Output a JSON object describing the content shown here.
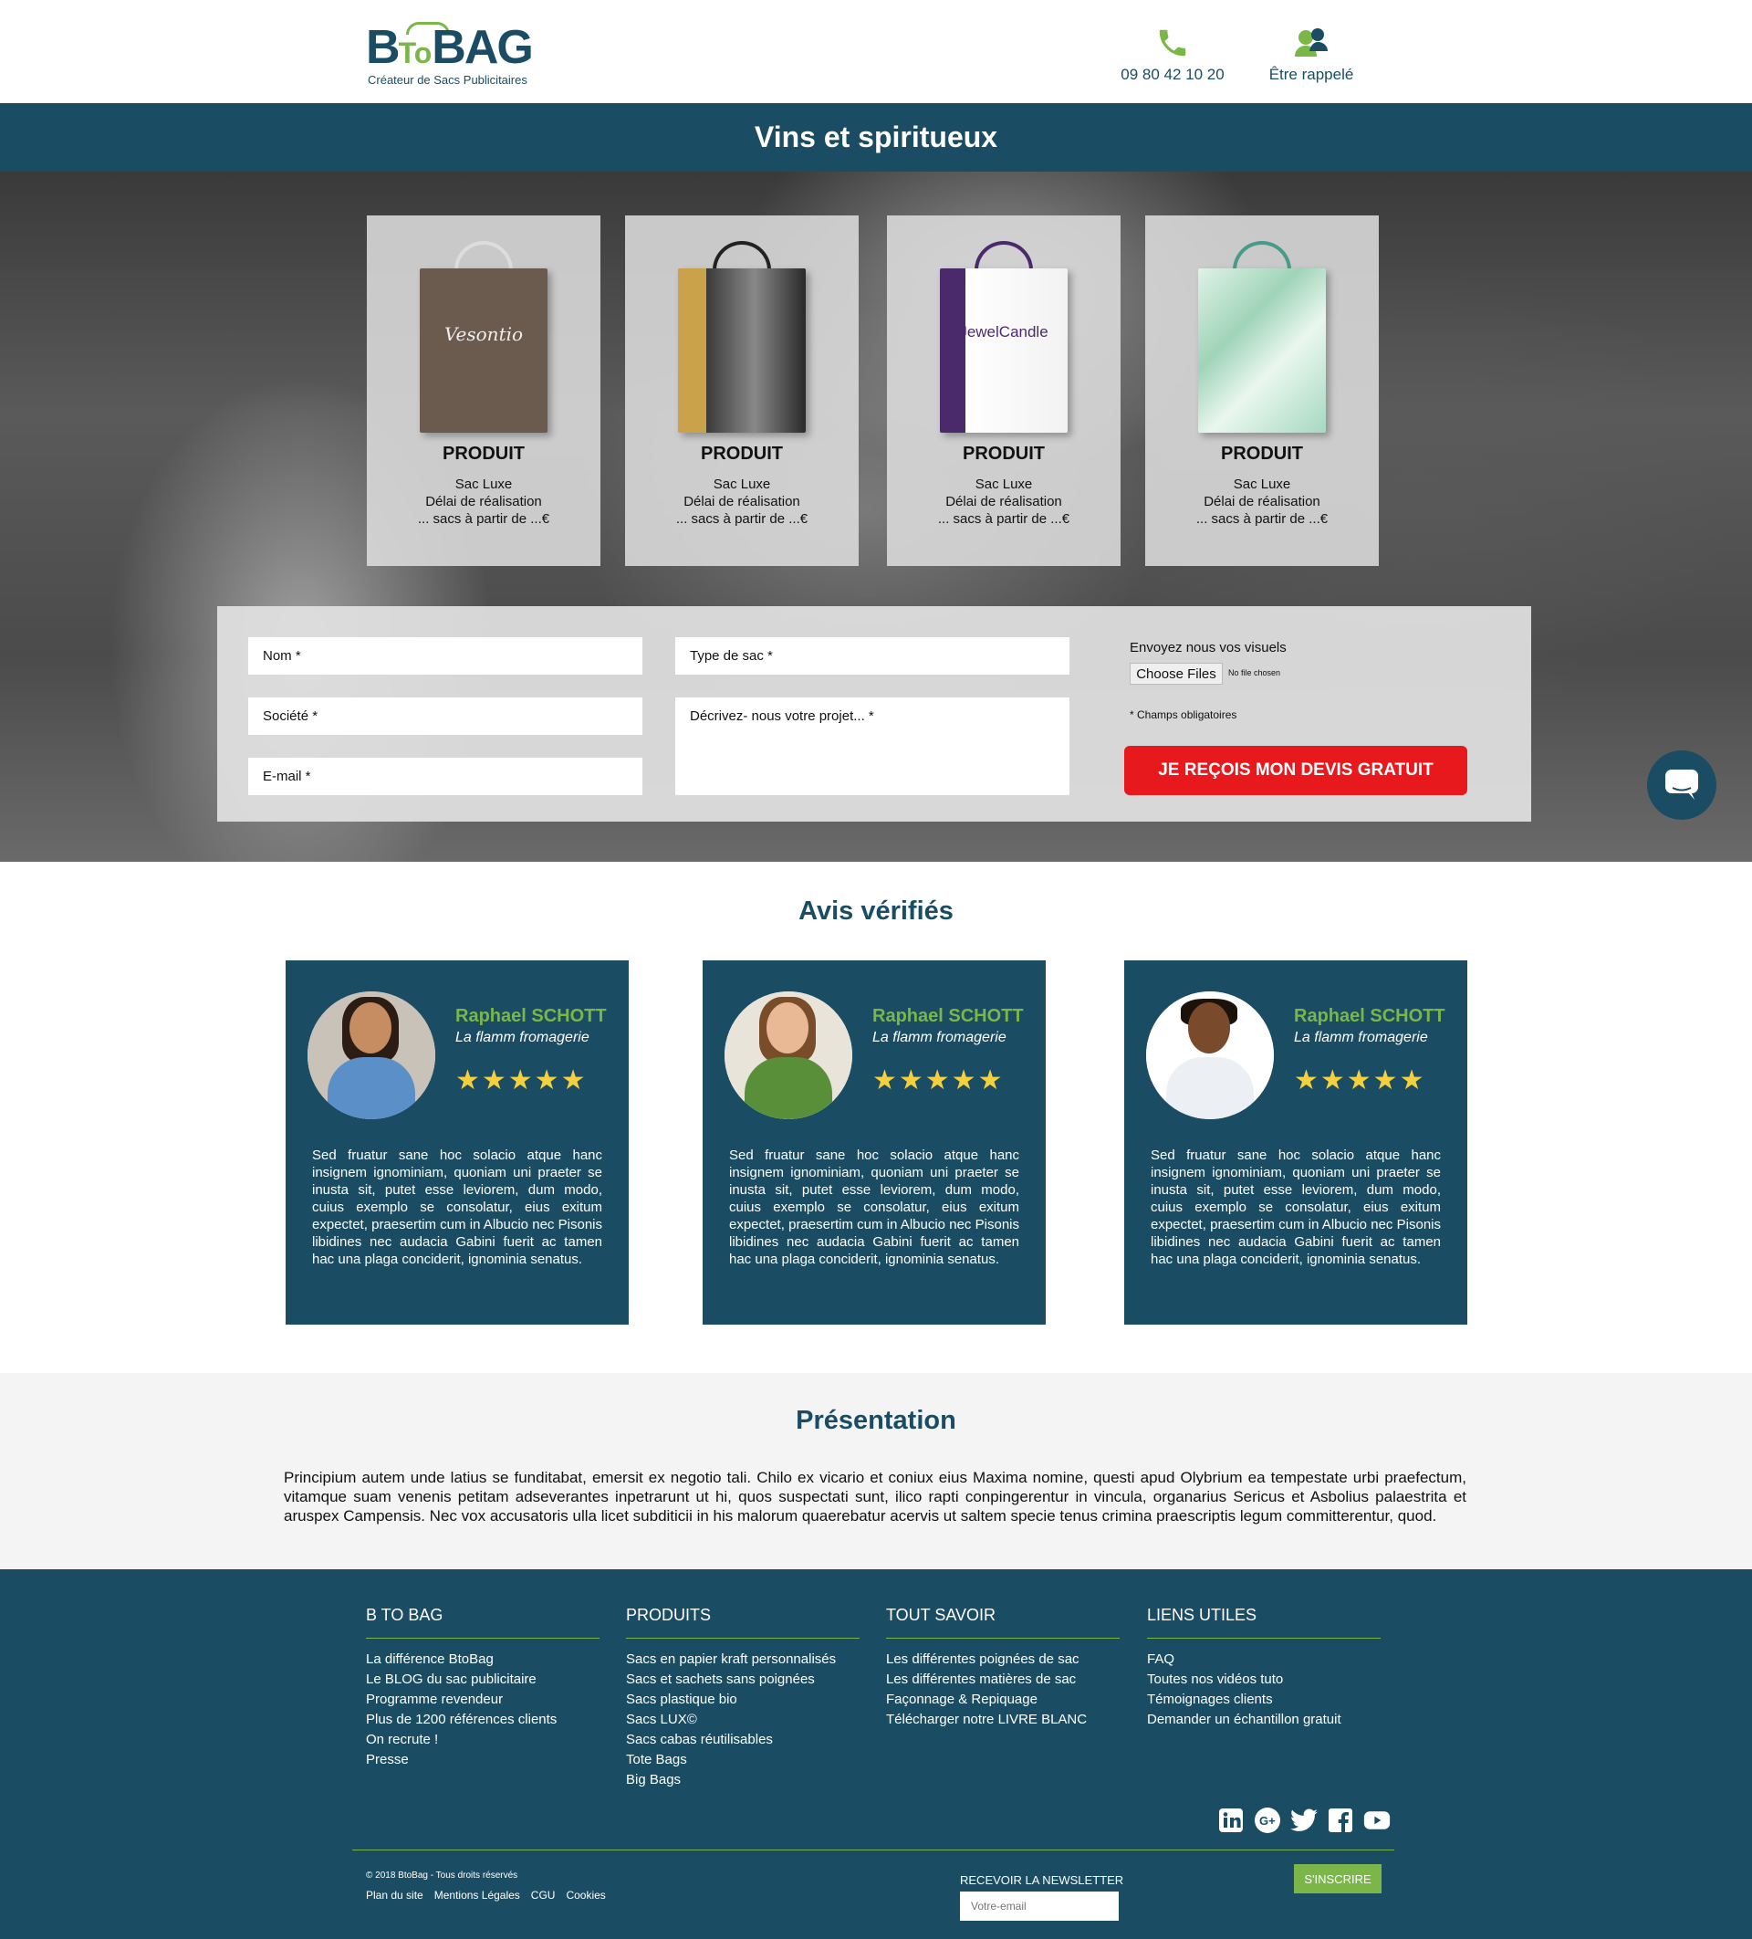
{
  "header": {
    "logo_main": "BtoBAG",
    "logo_tagline": "Créateur de Sacs Publicitaires",
    "phone": "09 80 42 10 20",
    "callback": "Être rappelé"
  },
  "page_title": "Vins et spiritueux",
  "products": [
    {
      "title": "PRODUIT",
      "line1": "Sac Luxe",
      "line2": "Délai de réalisation",
      "line3": "... sacs à partir de ...€",
      "bag_brand": "Vesontio",
      "bag_color": "#6b5a4e"
    },
    {
      "title": "PRODUIT",
      "line1": "Sac Luxe",
      "line2": "Délai de réalisation",
      "line3": "... sacs à partir de ...€",
      "bag_brand": "",
      "bag_color": "#c9a24a"
    },
    {
      "title": "PRODUIT",
      "line1": "Sac Luxe",
      "line2": "Délai de réalisation",
      "line3": "... sacs à partir de ...€",
      "bag_brand": "JewelCandle",
      "bag_color": "#4b2a6b"
    },
    {
      "title": "PRODUIT",
      "line1": "Sac Luxe",
      "line2": "Délai de réalisation",
      "line3": "... sacs à partir de ...€",
      "bag_brand": "",
      "bag_color": "#bfe3cf"
    }
  ],
  "form": {
    "nom": "Nom *",
    "societe": "Société *",
    "email": "E-mail *",
    "type_sac": "Type de sac *",
    "projet": "Décrivez- nous votre projet... *",
    "upload_label": "Envoyez nous vos visuels",
    "choose_files": "Choose Files",
    "no_file": "No file chosen",
    "required_note": "* Champs obligatoires",
    "submit": "JE REÇOIS MON DEVIS GRATUIT"
  },
  "reviews": {
    "title": "Avis vérifiés",
    "items": [
      {
        "name": "Raphael SCHOTT",
        "company": "La flamm fromagerie",
        "stars": "★★★★★",
        "text": "Sed fruatur sane hoc solacio atque hanc insignem ignominiam, quoniam uni praeter se inusta sit, putet esse leviorem, dum modo, cuius exemplo se consolatur, eius exitum expectet, praesertim cum in Albucio nec Pisonis libidines nec audacia Gabini fuerit ac tamen hac una plaga conciderit, ignominia senatus."
      },
      {
        "name": "Raphael SCHOTT",
        "company": "La flamm fromagerie",
        "stars": "★★★★★",
        "text": "Sed fruatur sane hoc solacio atque hanc insignem ignominiam, quoniam uni praeter se inusta sit, putet esse leviorem, dum modo, cuius exemplo se consolatur, eius exitum expectet, praesertim cum in Albucio nec Pisonis libidines nec audacia Gabini fuerit ac tamen hac una plaga conciderit, ignominia senatus."
      },
      {
        "name": "Raphael SCHOTT",
        "company": "La flamm fromagerie",
        "stars": "★★★★★",
        "text": "Sed fruatur sane hoc solacio atque hanc insignem ignominiam, quoniam uni praeter se inusta sit, putet esse leviorem, dum modo, cuius exemplo se consolatur, eius exitum expectet, praesertim cum in Albucio nec Pisonis libidines nec audacia Gabini fuerit ac tamen hac una plaga conciderit, ignominia senatus."
      }
    ]
  },
  "presentation": {
    "title": "Présentation",
    "text": "Principium autem unde latius se funditabat, emersit ex negotio tali. Chilo ex vicario et coniux eius Maxima nomine, questi apud Olybrium ea tempestate urbi praefectum, vitamque suam venenis petitam adseverantes inpetrarunt ut hi, quos suspectati sunt, ilico rapti conpingerentur in vincula, organarius Sericus et Asbolius palaestrita et aruspex Campensis. Nec vox accusatoris ulla licet subditicii in his malorum quaerebatur acervis ut saltem specie tenus crimina praescriptis legum committerentur, quod."
  },
  "footer": {
    "columns": [
      {
        "title": "B TO BAG",
        "items": [
          "La différence BtoBag",
          "Le BLOG du sac publicitaire",
          "Programme revendeur",
          "Plus de 1200 références clients",
          "On recrute !",
          "Presse"
        ]
      },
      {
        "title": "PRODUITS",
        "items": [
          "Sacs en papier kraft personnalisés",
          "Sacs et sachets sans poignées",
          "Sacs plastique bio",
          "Sacs LUX©",
          "Sacs cabas réutilisables",
          "Tote Bags",
          "Big Bags"
        ]
      },
      {
        "title": "TOUT SAVOIR",
        "items": [
          "Les différentes poignées de sac",
          "Les différentes matières de sac",
          "Façonnage & Repiquage",
          "Télécharger notre LIVRE BLANC"
        ]
      },
      {
        "title": "LIENS UTILES",
        "items": [
          "FAQ",
          "Toutes nos vidéos tuto",
          "Témoignages clients",
          "Demander un échantillon gratuit"
        ]
      }
    ],
    "socials": [
      "linkedin-icon",
      "google-plus-icon",
      "twitter-icon",
      "facebook-icon",
      "youtube-icon"
    ],
    "copyright": "© 2018 BtoBag - Tous droits réservés",
    "links": [
      "Plan du site",
      "Mentions Légales",
      "CGU",
      "Cookies"
    ],
    "newsletter_label": "RECEVOIR LA NEWSLETTER",
    "newsletter_placeholder": "Votre-email",
    "newsletter_button": "S'INSCRIRE"
  },
  "colors": {
    "primary": "#1a4d63",
    "accent": "#7ab648",
    "cta": "#e8191d",
    "stars": "#f4d03f"
  }
}
